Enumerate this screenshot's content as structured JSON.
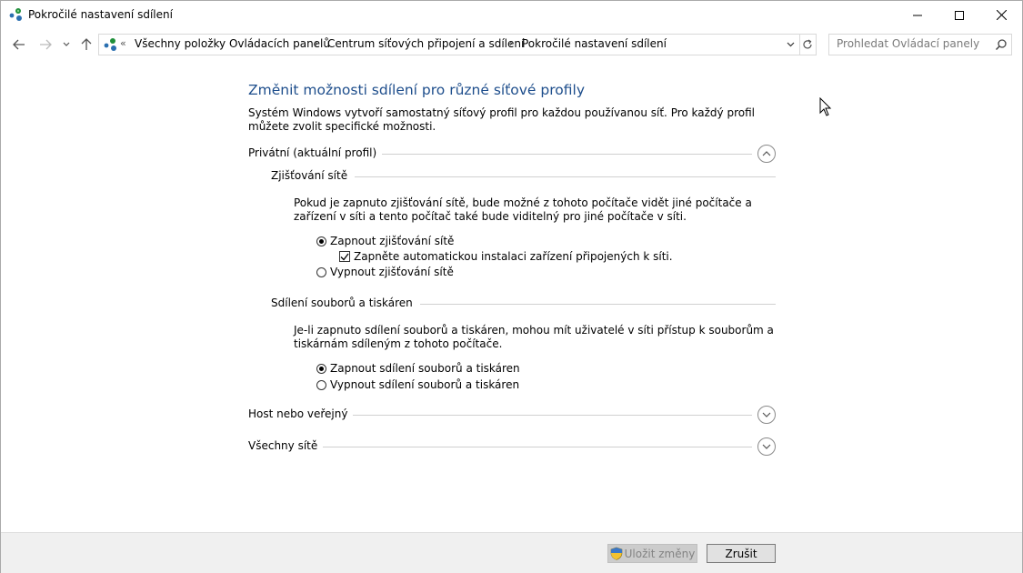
{
  "window": {
    "title": "Pokročilé nastavení sdílení",
    "icon": "network-sharing-icon"
  },
  "navigation": {
    "breadcrumb_overflow": "«",
    "breadcrumbs": [
      "Všechny položky Ovládacích panelů",
      "Centrum síťových připojení a sdílení",
      "Pokročilé nastavení sdílení"
    ],
    "search_placeholder": "Prohledat Ovládací panely"
  },
  "main": {
    "heading": "Změnit možnosti sdílení pro různé síťové profily",
    "description": "Systém Windows vytvoří samostatný síťový profil pro každou používanou síť. Pro každý profil můžete zvolit specifické možnosti.",
    "profiles": [
      {
        "title": "Privátní (aktuální profil)",
        "expanded": true,
        "sections": [
          {
            "title": "Zjišťování sítě",
            "description": "Pokud je zapnuto zjišťování sítě, bude možné z tohoto počítače vidět jiné počítače a zařízení v síti a tento počítač také bude viditelný pro jiné počítače v síti.",
            "option_on": "Zapnout zjišťování sítě",
            "option_auto": "Zapněte automatickou instalaci zařízení připojených k síti.",
            "option_off": "Vypnout zjišťování sítě",
            "selected": "on",
            "auto_checked": true
          },
          {
            "title": "Sdílení souborů a tiskáren",
            "description": "Je-li zapnuto sdílení souborů a tiskáren, mohou mít uživatelé v síti přístup k souborům a tiskárnám sdíleným z tohoto počítače.",
            "option_on": "Zapnout sdílení souborů a tiskáren",
            "option_off": "Vypnout sdílení souborů a tiskáren",
            "selected": "on"
          }
        ]
      },
      {
        "title": "Host nebo veřejný",
        "expanded": false
      },
      {
        "title": "Všechny sítě",
        "expanded": false
      }
    ]
  },
  "footer": {
    "save_label": "Uložit změny",
    "cancel_label": "Zrušit"
  }
}
